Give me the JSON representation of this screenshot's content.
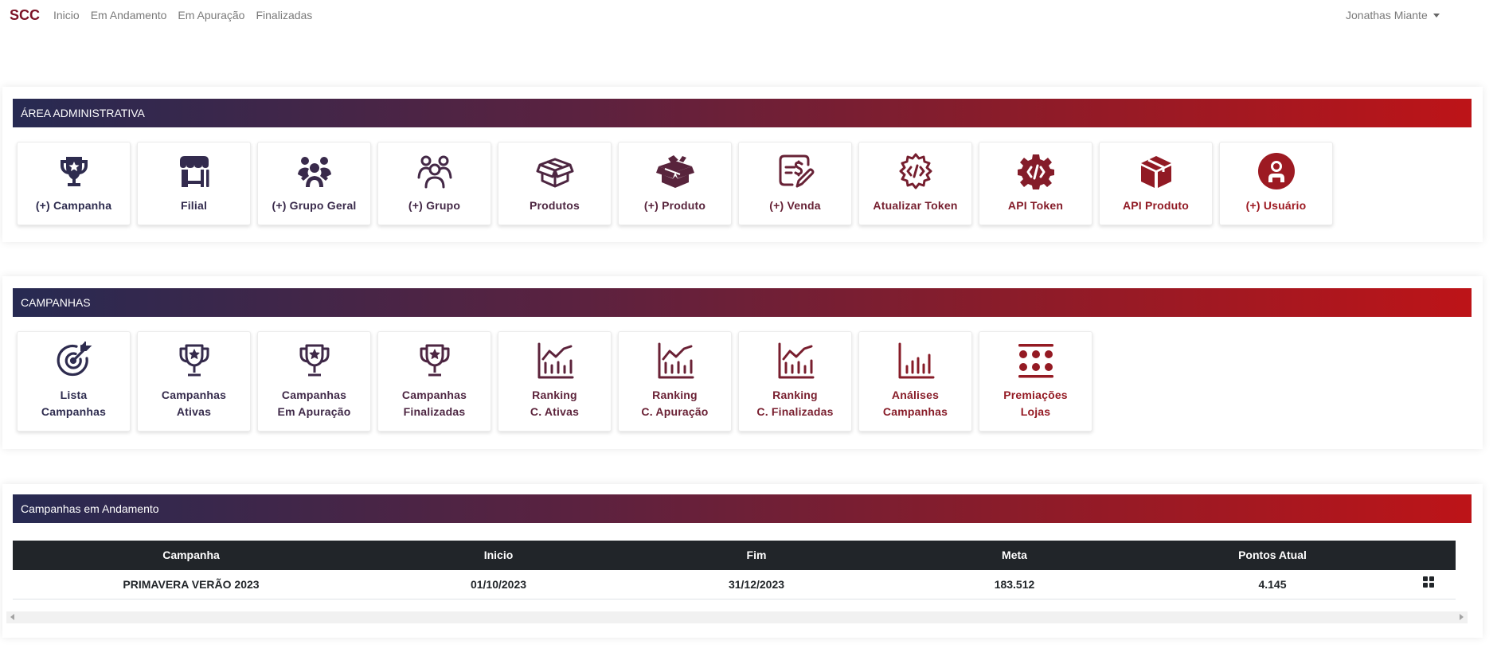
{
  "nav": {
    "brand": "SCC",
    "links": [
      "Inicio",
      "Em Andamento",
      "Em Apuração",
      "Finalizadas"
    ],
    "user": "Jonathas Miante"
  },
  "admin": {
    "title": "ÁREA ADMINISTRATIVA",
    "tiles": [
      {
        "label": "(+) Campanha",
        "icon": "trophy-icon",
        "color": "#2e2c4f"
      },
      {
        "label": "Filial",
        "icon": "store-icon",
        "color": "#332b4e"
      },
      {
        "label": "(+) Grupo Geral",
        "icon": "users-group-icon",
        "color": "#392a4b"
      },
      {
        "label": "(+) Grupo",
        "icon": "users-outline-icon",
        "color": "#432846"
      },
      {
        "label": "Produtos",
        "icon": "box-outline-icon",
        "color": "#4d2641"
      },
      {
        "label": "(+) Produto",
        "icon": "box-open-icon",
        "color": "#58243c"
      },
      {
        "label": "(+) Venda",
        "icon": "sale-edit-icon",
        "color": "#672236"
      },
      {
        "label": "Atualizar Token",
        "icon": "gear-code-outline-icon",
        "color": "#761f2f"
      },
      {
        "label": "API Token",
        "icon": "gear-code-solid-icon",
        "color": "#841c29"
      },
      {
        "label": "API Produto",
        "icon": "cube-icon",
        "color": "#911a24"
      },
      {
        "label": "(+) Usuário",
        "icon": "user-circle-icon",
        "color": "#9d1a22"
      }
    ]
  },
  "campaigns": {
    "title": "CAMPANHAS",
    "tiles": [
      {
        "lines": [
          "Lista",
          "Campanhas"
        ],
        "icon": "target-icon",
        "color": "#2e2c4f"
      },
      {
        "lines": [
          "Campanhas",
          "Ativas"
        ],
        "icon": "trophy-icon",
        "color": "#352b4c"
      },
      {
        "lines": [
          "Campanhas",
          "Em Apuração"
        ],
        "icon": "trophy-icon",
        "color": "#3f2948"
      },
      {
        "lines": [
          "Campanhas",
          "Finalizadas"
        ],
        "icon": "trophy-icon",
        "color": "#4d2642"
      },
      {
        "lines": [
          "Ranking",
          "C. Ativas"
        ],
        "icon": "chart-line-icon",
        "color": "#5c233b"
      },
      {
        "lines": [
          "Ranking",
          "C. Apuração"
        ],
        "icon": "chart-line-icon",
        "color": "#6a2135"
      },
      {
        "lines": [
          "Ranking",
          "C. Finalizadas"
        ],
        "icon": "chart-line-icon",
        "color": "#781e2e"
      },
      {
        "lines": [
          "Análises",
          "Campanhas"
        ],
        "icon": "chart-bar-icon",
        "color": "#871c28"
      },
      {
        "lines": [
          "Premiações",
          "Lojas"
        ],
        "icon": "dots-grid-icon",
        "color": "#941a23"
      }
    ]
  },
  "running": {
    "title": "Campanhas em Andamento",
    "columns": [
      "Campanha",
      "Inicio",
      "Fim",
      "Meta",
      "Pontos Atual",
      ""
    ],
    "rows": [
      {
        "campanha": "PRIMAVERA VERÃO 2023",
        "inicio": "01/10/2023",
        "fim": "31/12/2023",
        "meta": "183.512",
        "pontos": "4.145",
        "action_icon": "grid-icon"
      }
    ]
  }
}
